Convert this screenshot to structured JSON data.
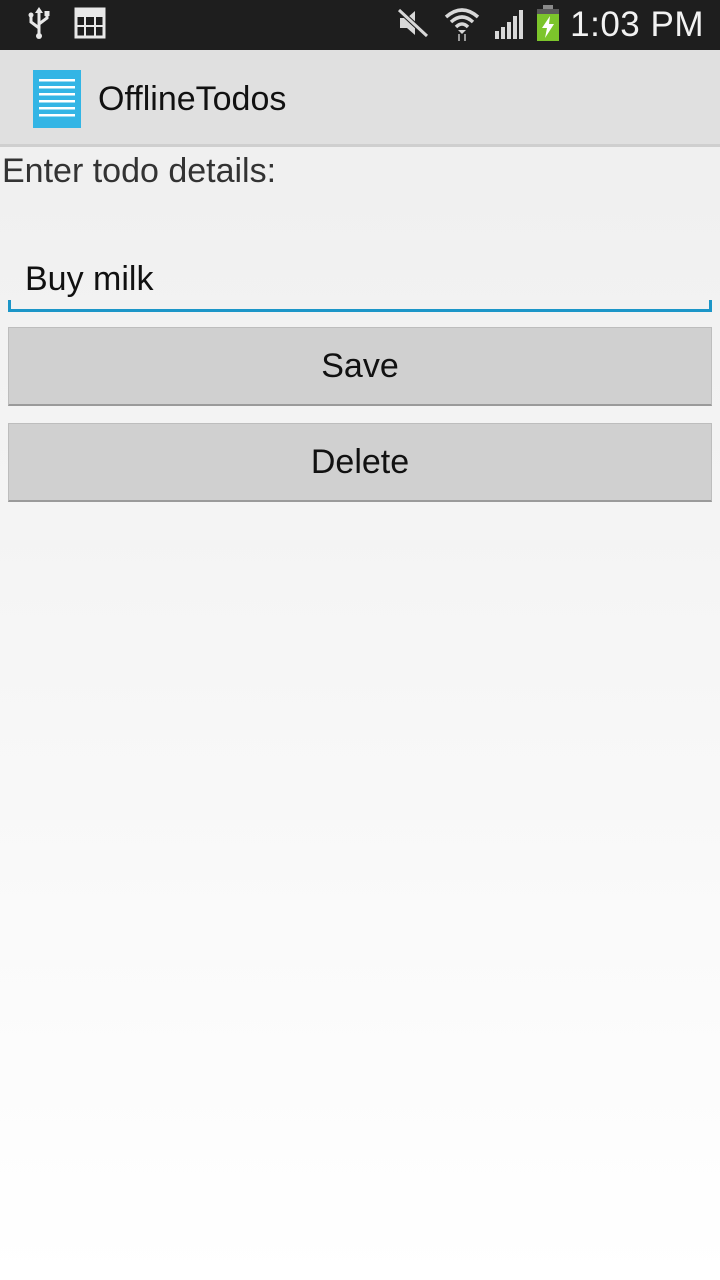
{
  "status_bar": {
    "time": "1:03 PM",
    "icons": [
      "usb-icon",
      "calendar-icon",
      "mute-icon",
      "wifi-icon",
      "signal-icon",
      "battery-charging-icon"
    ]
  },
  "action_bar": {
    "title": "OfflineTodos",
    "icon": "list-document-icon"
  },
  "form": {
    "prompt": "Enter todo details:",
    "todo_value": "Buy milk",
    "save_label": "Save",
    "delete_label": "Delete"
  },
  "colors": {
    "accent": "#1c96c8",
    "app_icon": "#33b5e5",
    "battery": "#7cc52b"
  }
}
